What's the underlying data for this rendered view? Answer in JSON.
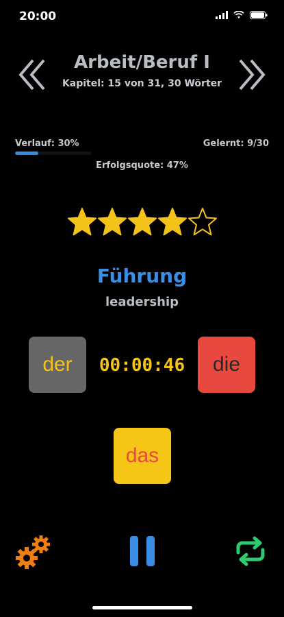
{
  "status_bar": {
    "time": "20:00"
  },
  "header": {
    "title": "Arbeit/Beruf I",
    "subtitle": "Kapitel: 15 von 31, 30 Wörter",
    "prev_icon": "double-chevron-left-icon",
    "next_icon": "double-chevron-right-icon"
  },
  "stats": {
    "progress_label": "Verlauf: 30%",
    "progress_value": 0.3,
    "learned": "Gelernt: 9/30",
    "success_rate": "Erfolgsquote: 47%"
  },
  "rating": {
    "filled": 4,
    "total": 5,
    "color": "#f4c31a"
  },
  "card": {
    "word": "Führung",
    "translation": "leadership"
  },
  "answers": {
    "der": "der",
    "die": "die",
    "das": "das",
    "timer": "00:00:46"
  },
  "toolbar": {
    "settings_icon": "gears-icon",
    "pause_icon": "pause-icon",
    "repeat_icon": "repeat-icon"
  },
  "colors": {
    "accent_blue": "#3a8ee6",
    "yellow": "#f4c31a",
    "red": "#e8483d",
    "green": "#2ecc71",
    "orange": "#f07f12"
  }
}
